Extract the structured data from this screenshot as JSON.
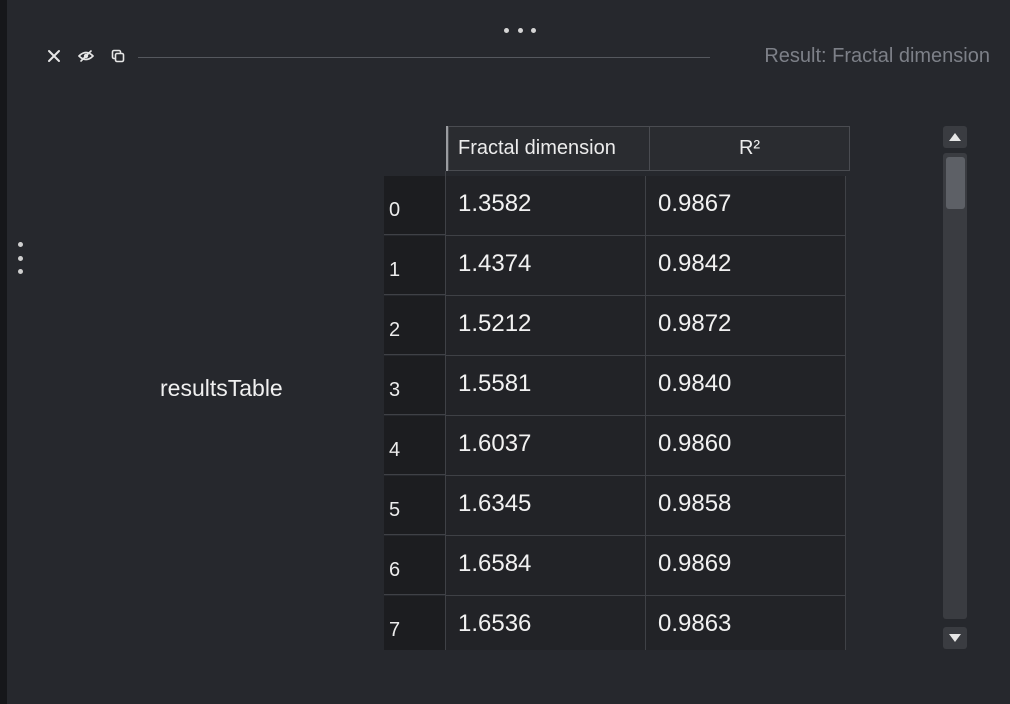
{
  "panel": {
    "title": "Result: Fractal dimension",
    "widget_label": "resultsTable"
  },
  "toolbar": {
    "icons": [
      "close-icon",
      "hide-eye-icon",
      "duplicate-icon"
    ]
  },
  "table": {
    "columns": [
      "Fractal dimension",
      "R²"
    ],
    "rows": [
      {
        "index": "0",
        "fd": "1.3582",
        "r2": "0.9867"
      },
      {
        "index": "1",
        "fd": "1.4374",
        "r2": "0.9842"
      },
      {
        "index": "2",
        "fd": "1.5212",
        "r2": "0.9872"
      },
      {
        "index": "3",
        "fd": "1.5581",
        "r2": "0.9840"
      },
      {
        "index": "4",
        "fd": "1.6037",
        "r2": "0.9860"
      },
      {
        "index": "5",
        "fd": "1.6345",
        "r2": "0.9858"
      },
      {
        "index": "6",
        "fd": "1.6584",
        "r2": "0.9869"
      },
      {
        "index": "7",
        "fd": "1.6536",
        "r2": "0.9863"
      }
    ]
  },
  "colors": {
    "background": "#26282d",
    "cell": "#222327",
    "index_cell": "#1c1d20",
    "title_text": "#7d8088"
  }
}
